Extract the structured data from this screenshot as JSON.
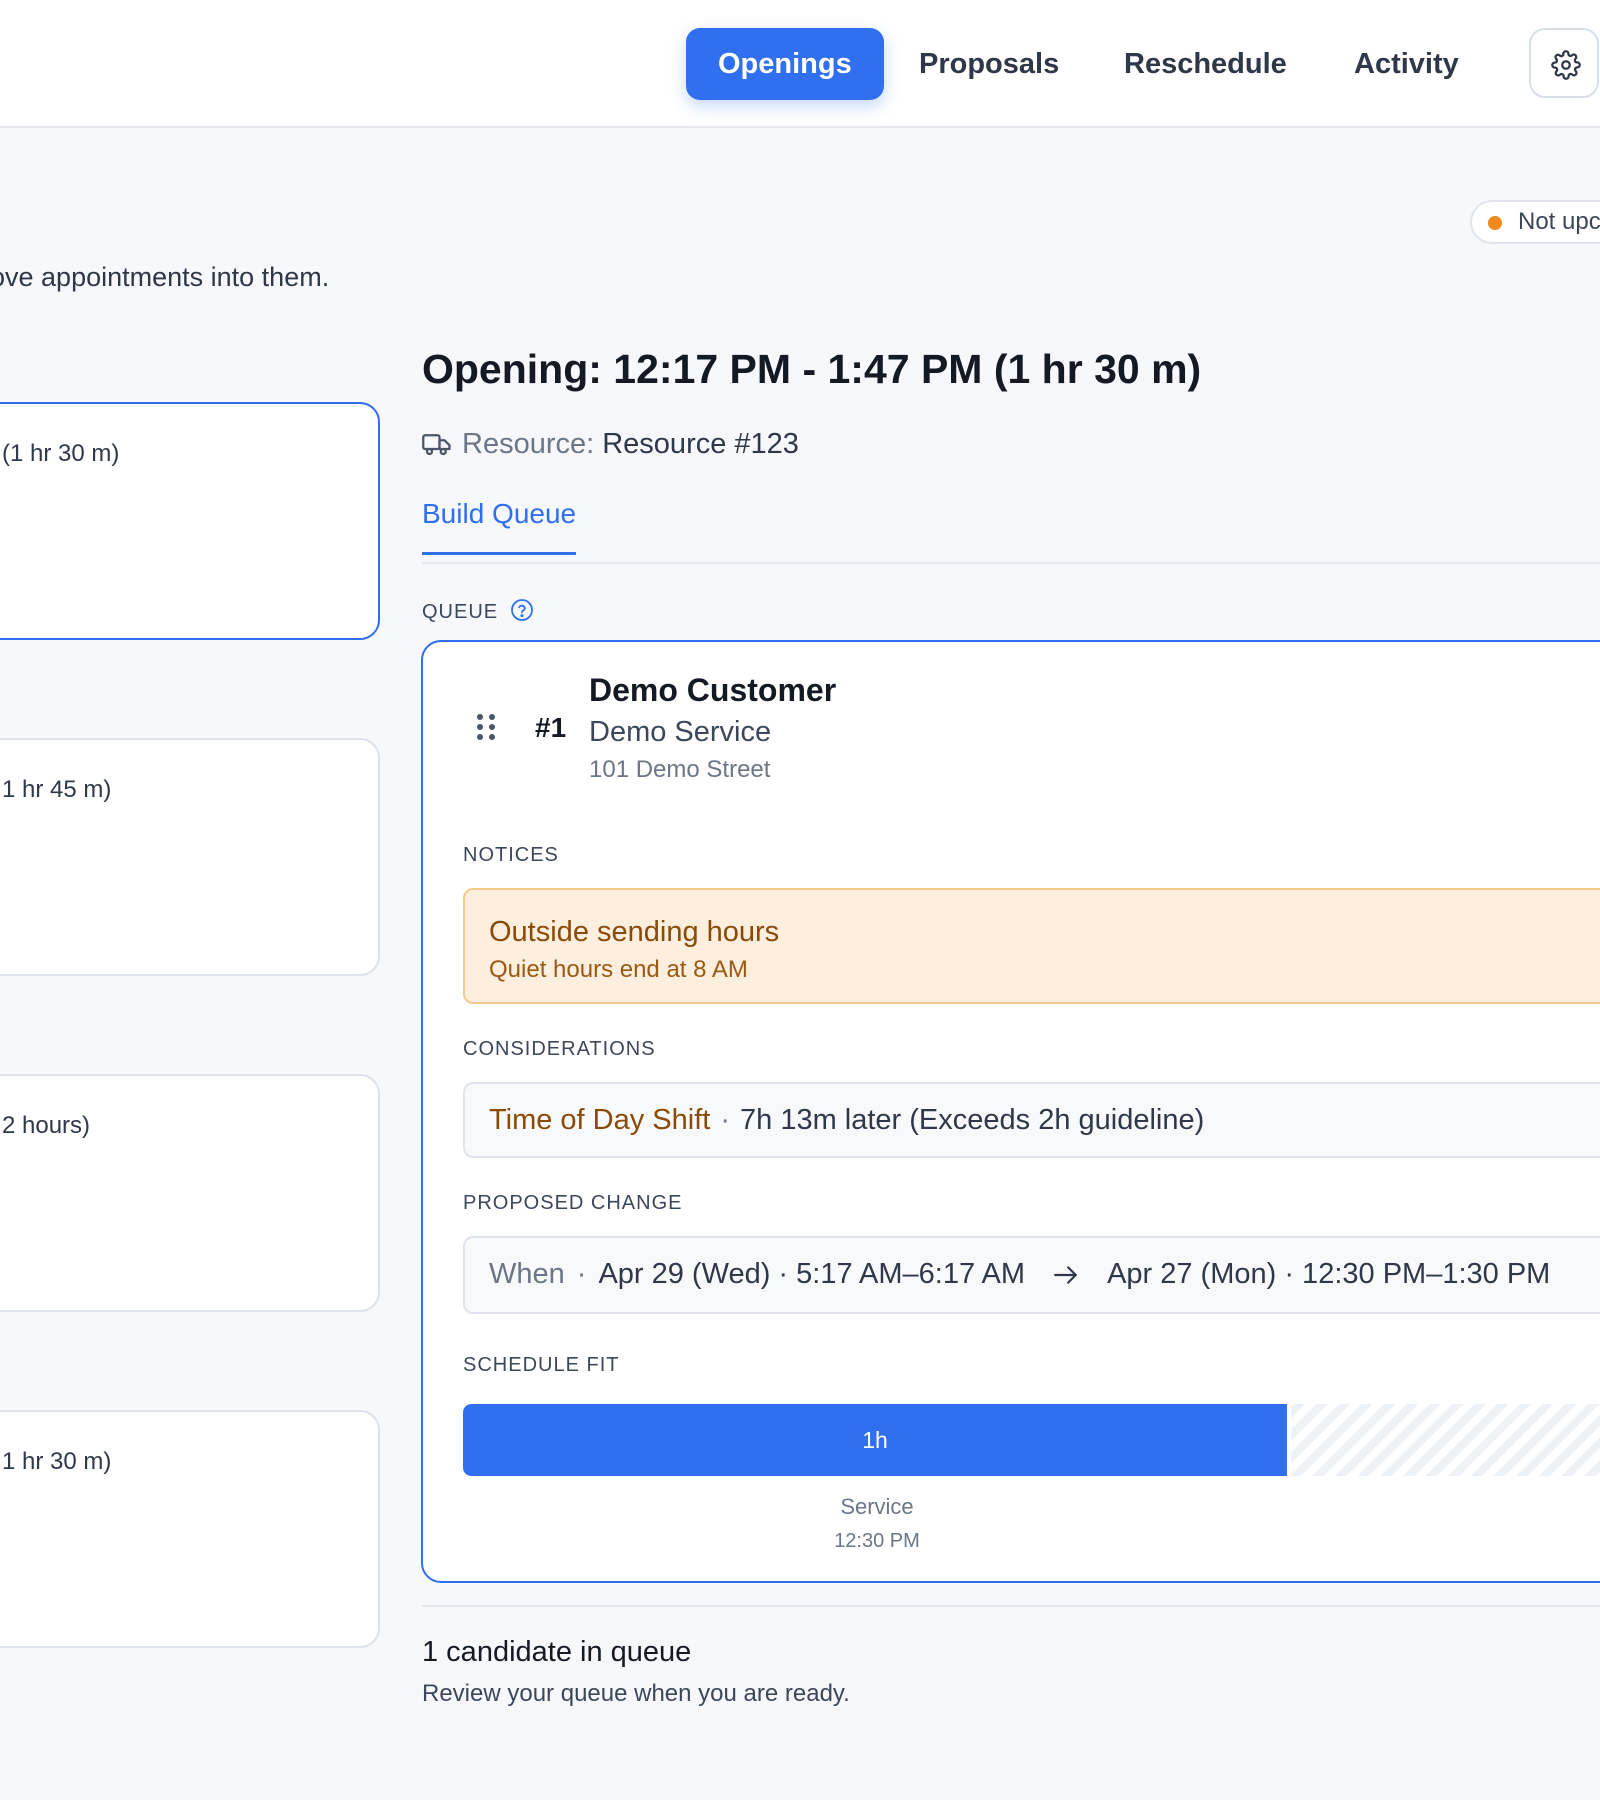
{
  "nav": {
    "tabs": [
      {
        "label": "Openings",
        "active": true
      },
      {
        "label": "Proposals",
        "active": false
      },
      {
        "label": "Reschedule",
        "active": false
      },
      {
        "label": "Activity",
        "active": false
      }
    ],
    "settings_icon": "gear-icon"
  },
  "status": {
    "text": "Not upc",
    "dot_color": "#f08a1c"
  },
  "intro": {
    "text": "ove appointments into them."
  },
  "openings_list": [
    {
      "text": "(1 hr 30 m)",
      "selected": true
    },
    {
      "text": "1 hr 45 m)",
      "selected": false
    },
    {
      "text": "2 hours)",
      "selected": false
    },
    {
      "text": "1 hr 30 m)",
      "selected": false
    }
  ],
  "detail": {
    "title": "Opening: 12:17 PM - 1:47 PM (1 hr 30 m)",
    "resource_icon": "truck-icon",
    "resource_label": "Resource:",
    "resource_value": "Resource #123",
    "subtab": "Build Queue"
  },
  "queue": {
    "label": "QUEUE",
    "help_icon": "question-icon",
    "items": [
      {
        "rank": "#1",
        "customer": "Demo Customer",
        "service": "Demo Service",
        "address": "101 Demo Street",
        "notices_label": "NOTICES",
        "notice_title": "Outside sending hours",
        "notice_detail": "Quiet hours end at 8 AM",
        "considerations_label": "CONSIDERATIONS",
        "consideration_type": "Time of Day Shift",
        "consideration_sep": "·",
        "consideration_detail": "7h 13m later (Exceeds 2h guideline)",
        "proposed_label": "PROPOSED CHANGE",
        "change_when_label": "When",
        "change_sep": "·",
        "change_from": "Apr 29 (Wed) · 5:17 AM–6:17 AM",
        "change_to": "Apr 27 (Mon) · 12:30 PM–1:30 PM",
        "schedule_fit_label": "SCHEDULE FIT",
        "fit_bar_label": "1h",
        "fit_caption_name": "Service",
        "fit_caption_time": "12:30 PM",
        "fit_fraction": 0.69
      }
    ]
  },
  "footer": {
    "count": "1 candidate in queue",
    "hint": "Review your queue when you are ready."
  },
  "colors": {
    "accent": "#2f6ff0",
    "notice_bg": "#fdeedd",
    "notice_text": "#8a4a08"
  }
}
